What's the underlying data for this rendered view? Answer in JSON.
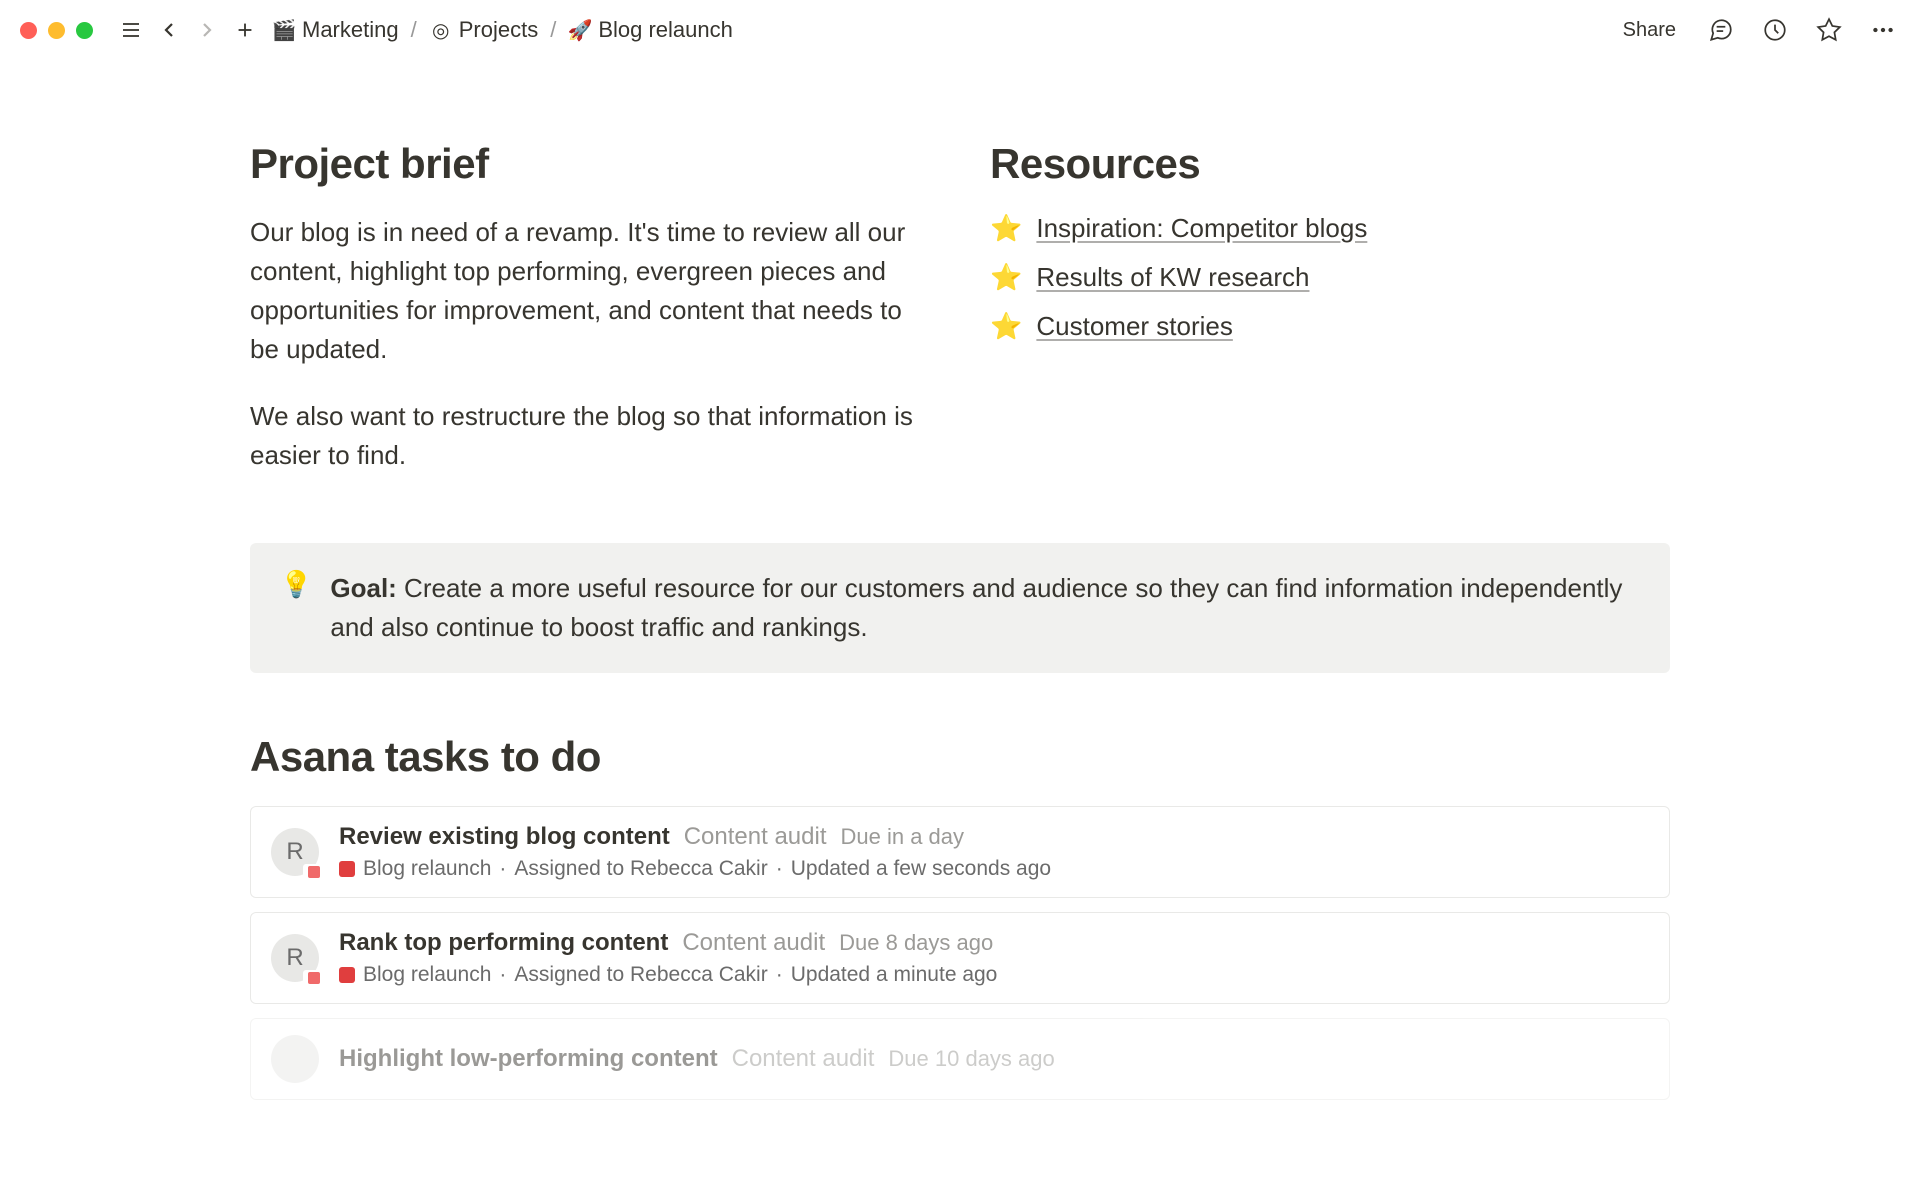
{
  "topbar": {
    "breadcrumb": [
      {
        "icon": "🎬",
        "label": "Marketing"
      },
      {
        "icon": "◎",
        "label": "Projects"
      },
      {
        "icon": "🚀",
        "label": "Blog relaunch"
      }
    ],
    "share": "Share"
  },
  "brief": {
    "heading": "Project brief",
    "para1": "Our blog is in need of a revamp. It's time to review all our content, highlight top performing, evergreen pieces and opportunities for improvement, and content that needs to be updated.",
    "para2": "We also want to restructure the blog so that information is easier to find."
  },
  "resources": {
    "heading": "Resources",
    "items": [
      {
        "icon": "⭐",
        "label": "Inspiration: Competitor blogs"
      },
      {
        "icon": "⭐",
        "label": "Results of KW research"
      },
      {
        "icon": "⭐",
        "label": "Customer stories"
      }
    ]
  },
  "callout": {
    "icon": "💡",
    "bold": "Goal:",
    "text": " Create a more useful resource for our customers and audience so they can find information independently and also continue to boost traffic and rankings."
  },
  "tasks": {
    "heading": "Asana tasks to do",
    "items": [
      {
        "avatar": "R",
        "title": "Review existing blog content",
        "category": "Content audit",
        "due": "Due in a day",
        "project": "Blog relaunch",
        "assignee": "Assigned to Rebecca Cakir",
        "updated": "Updated a few seconds ago"
      },
      {
        "avatar": "R",
        "title": "Rank top performing content",
        "category": "Content audit",
        "due": "Due 8 days ago",
        "project": "Blog relaunch",
        "assignee": "Assigned to Rebecca Cakir",
        "updated": "Updated a minute ago"
      },
      {
        "avatar": "",
        "title": "Highlight low-performing content",
        "category": "Content audit",
        "due": "Due 10 days ago",
        "project": "",
        "assignee": "",
        "updated": ""
      }
    ]
  }
}
